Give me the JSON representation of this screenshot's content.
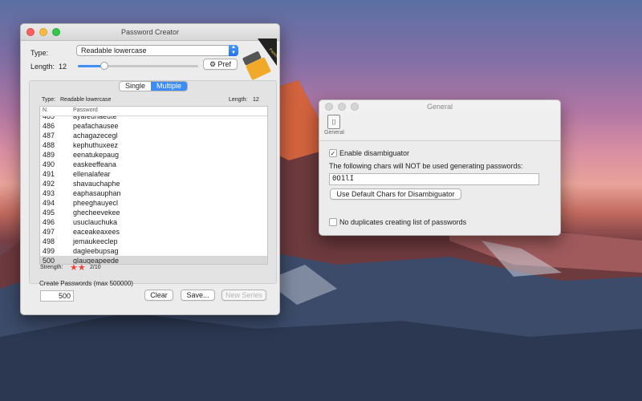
{
  "password_window": {
    "title": "Password Creator",
    "type_label": "Type:",
    "type_value": "Readable lowercase",
    "length_label": "Length:",
    "length_value": "12",
    "length_slider_fraction": 0.22,
    "pref_button": "Pref",
    "segment": {
      "single": "Single",
      "multiple": "Multiple",
      "selected": "Multiple"
    },
    "info_type_label": "Type:",
    "info_type_value": "Readable lowercase",
    "info_length_label": "Length:",
    "info_length_value": "12",
    "table": {
      "col_n": "N.",
      "col_password": "Password",
      "partial_top": {
        "n": "485",
        "password": "ayafeuhaeute"
      },
      "rows": [
        {
          "n": "486",
          "password": "peafachausee"
        },
        {
          "n": "487",
          "password": "achagazecegl"
        },
        {
          "n": "488",
          "password": "kephuthuxeez"
        },
        {
          "n": "489",
          "password": "eenatukepaug"
        },
        {
          "n": "490",
          "password": "easkeeffeana"
        },
        {
          "n": "491",
          "password": "ellenalafear"
        },
        {
          "n": "492",
          "password": "shavauchaphe"
        },
        {
          "n": "493",
          "password": "eaphasauphan"
        },
        {
          "n": "494",
          "password": "pheeghauyecl"
        },
        {
          "n": "495",
          "password": "ghecheevekee"
        },
        {
          "n": "496",
          "password": "usuclauchuka"
        },
        {
          "n": "497",
          "password": "eaceakeaxees"
        },
        {
          "n": "498",
          "password": "jemaukeeclep"
        },
        {
          "n": "499",
          "password": "dagleebupsag"
        },
        {
          "n": "500",
          "password": "glaugeapeede"
        }
      ],
      "selected_n": "500"
    },
    "strength_label": "Strength:",
    "strength_value": "2/10",
    "strength_stars": 2,
    "create_label": "Create Passwords (max 500000)",
    "create_count": "500",
    "clear_button": "Clear",
    "save_button": "Save...",
    "new_series_button": "New Series",
    "icon_badge_text": "Password"
  },
  "general_window": {
    "title": "General",
    "toolbar_item": "General",
    "enable_disambiguator_label": "Enable disambiguator",
    "enable_disambiguator_checked": true,
    "chars_label": "The following chars will NOT be used generating passwords:",
    "chars_value": "0O1lI",
    "default_chars_button": "Use Default Chars for Disambiguator",
    "no_duplicates_label": "No duplicates creating list of passwords",
    "no_duplicates_checked": false
  }
}
